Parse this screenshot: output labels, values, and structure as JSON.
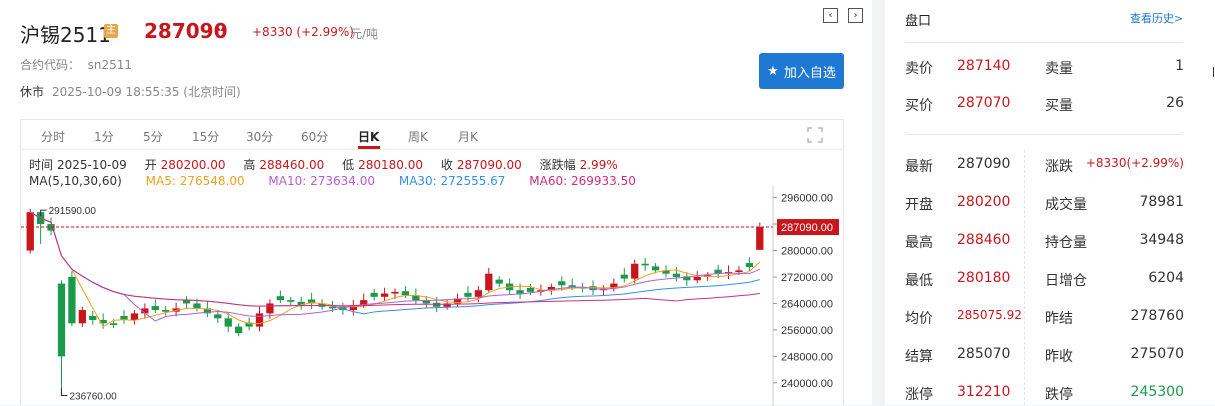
{
  "header": {
    "title": "沪锡2511",
    "badge": "主",
    "price": "287090",
    "change": "+8330 (+2.99%)",
    "unit": "元/吨",
    "code_label": "合约代码：",
    "code": "sn2511",
    "status": "休市",
    "time": "2025-10-09 18:55:35 (北京时间)",
    "prev_icon": "chevron-left-icon",
    "next_icon": "chevron-right-icon",
    "add_button": "加入自选",
    "add_icon": "star-icon",
    "accent_color": "#1f78d1",
    "up_color": "#c8161d",
    "down_color": "#1a9a4a"
  },
  "tabs": [
    "分时",
    "1分",
    "5分",
    "15分",
    "30分",
    "60分",
    "日K",
    "周K",
    "月K"
  ],
  "active_tab": "日K",
  "kline_info": {
    "time_label": "时间",
    "time": "2025-10-09",
    "open_label": "开",
    "open": "280200.00",
    "high_label": "高",
    "high": "288460.00",
    "low_label": "低",
    "low": "280180.00",
    "close_label": "收",
    "close": "287090.00",
    "pct_label": "涨跌幅",
    "pct": "2.99%"
  },
  "ma_info": {
    "ma_label": "MA(5,10,30,60)",
    "ma5": "MA5: 276548.00",
    "ma10": "MA10: 273634.00",
    "ma30": "MA30: 272555.67",
    "ma60": "MA60: 269933.50",
    "ma5_color": "#f0a020",
    "ma10_color": "#b060d0",
    "ma30_color": "#3a8ee6",
    "ma60_color": "#d0307a"
  },
  "chart_data": {
    "type": "candlestick",
    "y_ticks": [
      "296000.00",
      "288000.00",
      "280000.00",
      "272000.00",
      "264000.00",
      "256000.00",
      "248000.00",
      "240000.00"
    ],
    "ylim": [
      233000,
      299500
    ],
    "current_price_label": "287090.00",
    "current_price": 287090,
    "low_marker_label": "236760.00",
    "low_marker_value": 236760,
    "high_marker_label": "291590.00",
    "high_marker_value": 291590,
    "candles": []
  },
  "panel": {
    "title": "盘口",
    "history": "查看历史>",
    "rows_top": [
      {
        "l1": "卖价",
        "v1": "287140",
        "c1": "red",
        "l2": "卖量",
        "v2": "1",
        "c2": ""
      },
      {
        "l1": "买价",
        "v1": "287070",
        "c1": "red",
        "l2": "买量",
        "v2": "26",
        "c2": ""
      }
    ],
    "rows": [
      {
        "l1": "最新",
        "v1": "287090",
        "c1": "",
        "l2": "涨跌",
        "v2": "+8330(+2.99%)",
        "c2": "red"
      },
      {
        "l1": "开盘",
        "v1": "280200",
        "c1": "red",
        "l2": "成交量",
        "v2": "78981",
        "c2": ""
      },
      {
        "l1": "最高",
        "v1": "288460",
        "c1": "red",
        "l2": "持仓量",
        "v2": "34948",
        "c2": ""
      },
      {
        "l1": "最低",
        "v1": "280180",
        "c1": "red",
        "l2": "日增仓",
        "v2": "6204",
        "c2": ""
      },
      {
        "l1": "均价",
        "v1": "285075.92",
        "c1": "red",
        "l2": "昨结",
        "v2": "278760",
        "c2": ""
      },
      {
        "l1": "结算",
        "v1": "285070",
        "c1": "",
        "l2": "昨收",
        "v2": "275070",
        "c2": ""
      },
      {
        "l1": "涨停",
        "v1": "312210",
        "c1": "red",
        "l2": "跌停",
        "v2": "245300",
        "c2": "green"
      }
    ]
  }
}
